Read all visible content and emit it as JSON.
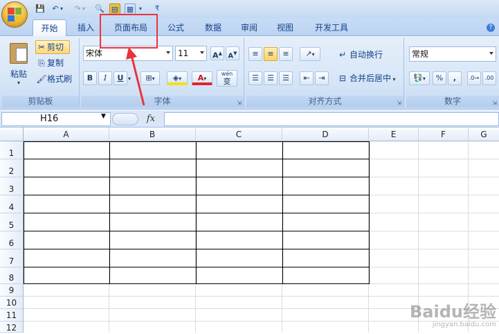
{
  "tabs": [
    "开始",
    "插入",
    "页面布局",
    "公式",
    "数据",
    "审阅",
    "视图",
    "开发工具"
  ],
  "clipboard": {
    "paste": "粘贴",
    "cut": "剪切",
    "copy": "复制",
    "format_painter": "格式刷",
    "group_label": "剪贴板"
  },
  "font": {
    "name": "宋体",
    "size": "11",
    "group_label": "字体",
    "bold": "B",
    "italic": "I",
    "underline": "U",
    "grow": "A",
    "shrink": "A",
    "font_color": "A",
    "phonetic": "wén",
    "phonetic2": "变"
  },
  "alignment": {
    "wrap": "自动换行",
    "merge": "合并后居中",
    "group_label": "对齐方式"
  },
  "number": {
    "format": "常规",
    "percent": "%",
    "comma": ",",
    "group_label": "数字"
  },
  "formula_bar": {
    "cell_ref": "H16",
    "fx": "fx",
    "value": ""
  },
  "columns": [
    "A",
    "B",
    "C",
    "D",
    "E",
    "F",
    "G"
  ],
  "rows": [
    "1",
    "2",
    "3",
    "4",
    "5",
    "6",
    "7",
    "8",
    "9",
    "10",
    "11",
    "12"
  ],
  "watermark": {
    "line1": "Baidu经验",
    "line2": "jingyan.baidu.com"
  },
  "colors": {
    "accent": "#e8343f",
    "ribbon": "#d7e6f7",
    "grid": "#dadcdd"
  }
}
